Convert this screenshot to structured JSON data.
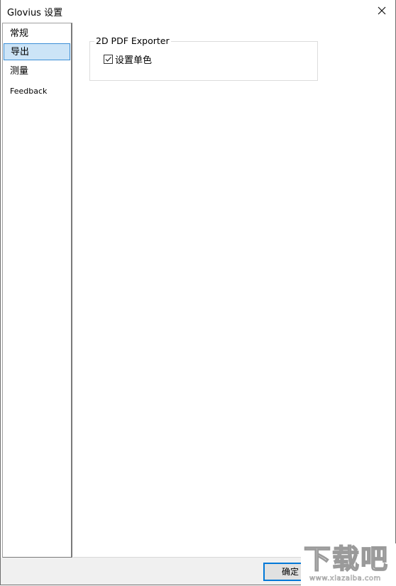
{
  "window": {
    "title": "Glovius 设置",
    "close_icon": "close-icon"
  },
  "sidebar": {
    "items": [
      {
        "label": "常规",
        "selected": false
      },
      {
        "label": "导出",
        "selected": true
      },
      {
        "label": "测量",
        "selected": false
      },
      {
        "label": "Feedback",
        "selected": false
      }
    ]
  },
  "content": {
    "group_title": "2D PDF Exporter",
    "checkbox_label": "设置单色",
    "checkbox_checked": true
  },
  "footer": {
    "ok_label": "确定"
  },
  "watermark": {
    "text": "下载吧",
    "url_text": "www.xiazaiba.com"
  },
  "colors": {
    "selection_bg": "#cce4f7",
    "selection_border": "#3c8fd6",
    "button_focus": "#0078d7",
    "footer_bg": "#f0f0f0"
  }
}
